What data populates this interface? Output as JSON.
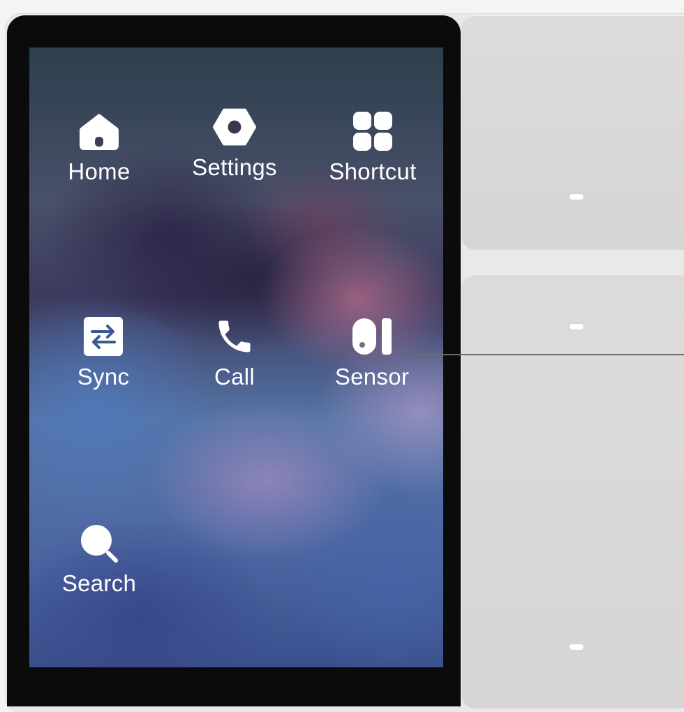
{
  "screen": {
    "apps": [
      {
        "label": "Home",
        "icon": "home-icon"
      },
      {
        "label": "Settings",
        "icon": "hex-nut-icon"
      },
      {
        "label": "Shortcut",
        "icon": "grid-icon"
      },
      {
        "label": "Sync",
        "icon": "swap-arrows-icon"
      },
      {
        "label": "Call",
        "icon": "phone-icon"
      },
      {
        "label": "Sensor",
        "icon": "sensor-icon"
      },
      {
        "label": "Search",
        "icon": "search-icon"
      }
    ]
  },
  "colors": {
    "bezel": "#0b0b0b",
    "key": "#d9d8d6",
    "indicator": "#ffffff",
    "label": "#ffffff"
  }
}
